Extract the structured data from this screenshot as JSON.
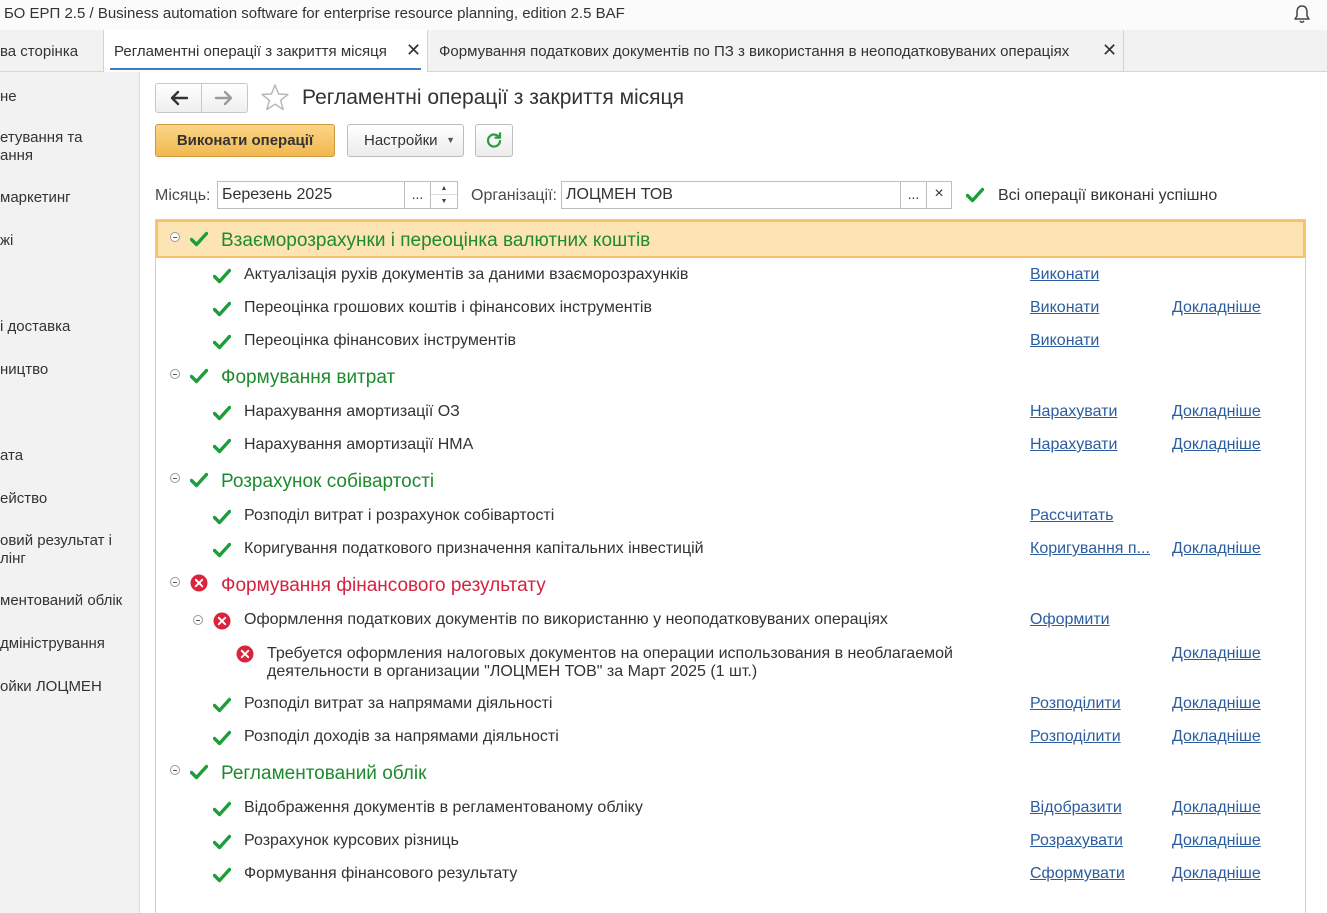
{
  "window": {
    "title": "БО ЕРП 2.5 / Business automation software for enterprise resource planning, edition 2.5 BAF"
  },
  "tabs": [
    {
      "label": "ва сторінка"
    },
    {
      "label": "Регламентні операції з закриття місяця"
    },
    {
      "label": "Формування податкових документів по ПЗ з використання в неоподатковуваних операціях"
    }
  ],
  "sidebar": {
    "items": [
      {
        "lines": [
          "не"
        ]
      },
      {
        "lines": [
          "етування та",
          "ання"
        ]
      },
      {
        "lines": [
          "маркетинг"
        ]
      },
      {
        "lines": [
          "жі"
        ]
      },
      {
        "lines": [
          "і доставка"
        ]
      },
      {
        "lines": [
          "ництво"
        ]
      },
      {
        "lines": [
          "ата"
        ]
      },
      {
        "lines": [
          "ейство"
        ]
      },
      {
        "lines": [
          "овий результат і",
          "лінг"
        ]
      },
      {
        "lines": [
          "ментований облік"
        ]
      },
      {
        "lines": [
          "дміністрування"
        ]
      },
      {
        "lines": [
          "ойки ЛОЦМЕН"
        ]
      }
    ]
  },
  "header": {
    "title": "Регламентні операції з закриття місяця"
  },
  "toolbar": {
    "execute_label": "Виконати операції",
    "settings_label": "Настройки"
  },
  "filters": {
    "month_label": "Місяць:",
    "month_value": "Березень 2025",
    "org_label": "Організації:",
    "org_value": "ЛОЦМЕН ТОВ",
    "select_glyph": "...",
    "clear_glyph": "×",
    "status_text": "Всі операції виконані успішно"
  },
  "groups": [
    {
      "title": "Взаєморозрахунки і переоцінка валютних коштів",
      "status": "ok",
      "ops": [
        {
          "label": "Актуалізація рухів документів за даними взаєморозрахунків",
          "status": "ok",
          "action": "Виконати",
          "details": ""
        },
        {
          "label": "Переоцінка грошових коштів і фінансових інструментів",
          "status": "ok",
          "action": "Виконати",
          "details": "Докладніше"
        },
        {
          "label": "Переоцінка фінансових інструментів",
          "status": "ok",
          "action": "Виконати",
          "details": ""
        }
      ]
    },
    {
      "title": "Формування витрат",
      "status": "ok",
      "ops": [
        {
          "label": "Нарахування амортизації ОЗ",
          "status": "ok",
          "action": "Нарахувати",
          "details": "Докладніше"
        },
        {
          "label": "Нарахування амортизації НМА",
          "status": "ok",
          "action": "Нарахувати",
          "details": "Докладніше"
        }
      ]
    },
    {
      "title": "Розрахунок собівартості",
      "status": "ok",
      "ops": [
        {
          "label": "Розподіл витрат і розрахунок собівартості",
          "status": "ok",
          "action": "Рассчитать",
          "details": ""
        },
        {
          "label": "Коригування податкового призначення капітальних інвестицій",
          "status": "ok",
          "action": "Коригування п...",
          "details": "Докладніше"
        }
      ]
    },
    {
      "title": "Формування фінансового результату",
      "status": "error",
      "ops": [
        {
          "label": "Оформлення податкових документів по використанню у неоподатковуваних операціях",
          "status": "error",
          "action": "Оформити",
          "details": ""
        },
        {
          "label": "Требуется оформления налоговых документов на операции использования в необлагаемой деятельности в организации \"ЛОЦМЕН ТОВ\" за Март 2025 (1 шт.)",
          "status": "error",
          "action": "",
          "details": "Докладніше"
        },
        {
          "label": "Розподіл витрат за напрямами діяльності",
          "status": "ok",
          "action": "Розподілити",
          "details": "Докладніше"
        },
        {
          "label": "Розподіл доходів за напрямами діяльності",
          "status": "ok",
          "action": "Розподілити",
          "details": "Докладніше"
        }
      ]
    },
    {
      "title": "Регламентований облік",
      "status": "ok",
      "ops": [
        {
          "label": "Відображення документів в регламентованому обліку",
          "status": "ok",
          "action": "Відобразити",
          "details": "Докладніше"
        },
        {
          "label": "Розрахунок курсових різниць",
          "status": "ok",
          "action": "Розрахувати",
          "details": "Докладніше"
        },
        {
          "label": "Формування фінансового результату",
          "status": "ok",
          "action": "Сформувати",
          "details": "Докладніше"
        }
      ]
    }
  ],
  "colors": {
    "ok": "#1e9e3a",
    "error": "#d9243c",
    "link": "#2b5d9e",
    "accent": "#f1b84f"
  }
}
